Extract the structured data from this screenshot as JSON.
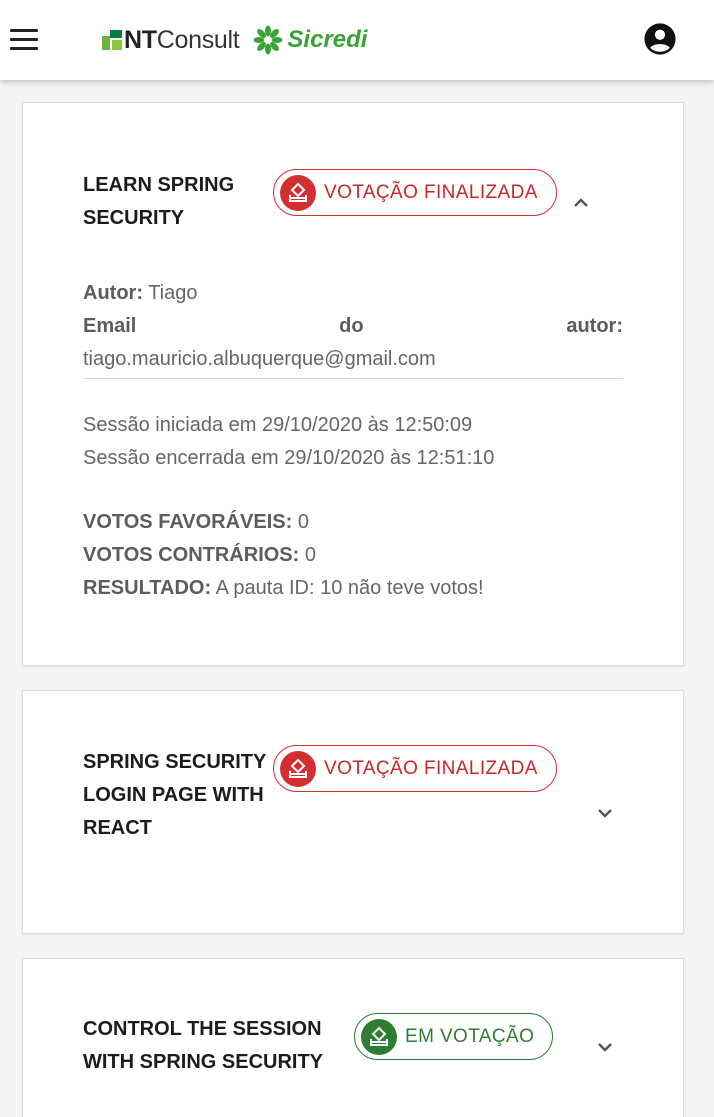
{
  "header": {
    "brand_nt_bold": "NT",
    "brand_nt_rest": "Consult",
    "brand_sicredi": "Sicredi"
  },
  "cards": [
    {
      "title": "LEARN SPRING SECURITY",
      "status": "VOTAÇÃO FINALIZADA",
      "expanded": true,
      "author_label": "Autor:",
      "author": "Tiago",
      "email_label_1": "Email",
      "email_label_2": "do",
      "email_label_3": "autor:",
      "email": "tiago.mauricio.albuquerque@gmail.com",
      "session_start": "Sessão iniciada em 29/10/2020 às 12:50:09",
      "session_end": "Sessão encerrada em 29/10/2020 às 12:51:10",
      "votes_for_label": "VOTOS FAVORÁVEIS:",
      "votes_for": "0",
      "votes_against_label": "VOTOS CONTRÁRIOS:",
      "votes_against": "0",
      "result_label": "RESULTADO:",
      "result": "A pauta ID: 10 não teve votos!"
    },
    {
      "title": "SPRING SECURITY LOGIN PAGE WITH REACT",
      "status": "VOTAÇÃO FINALIZADA",
      "expanded": false
    },
    {
      "title": "CONTROL THE SESSION WITH SPRING SECURITY",
      "status": "EM VOTAÇÃO",
      "expanded": false
    }
  ],
  "colors": {
    "finalizada": "#d32f2f",
    "em_votacao": "#2e7d32",
    "brand_green": "#3aa335"
  }
}
